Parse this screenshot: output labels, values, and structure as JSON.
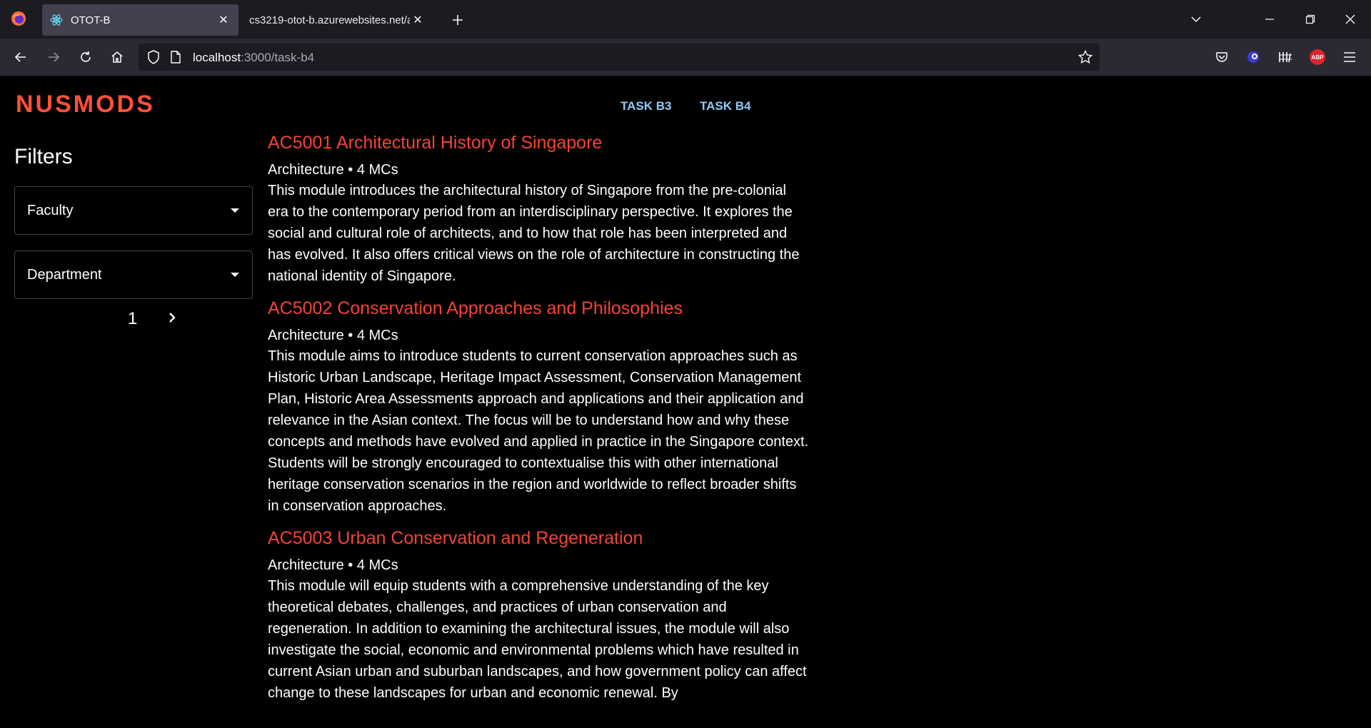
{
  "browser": {
    "tabs": [
      {
        "title": "OTOT-B",
        "active": true
      },
      {
        "title": "cs3219-otot-b.azurewebsites.net/ap",
        "active": false
      }
    ],
    "url": {
      "host": "localhost",
      "rest": ":3000/task-b4"
    }
  },
  "app": {
    "logo": "NUSMODS",
    "nav": [
      "TASK B3",
      "TASK B4"
    ]
  },
  "filters": {
    "title": "Filters",
    "faculty": "Faculty",
    "department": "Department",
    "page": "1"
  },
  "modules": [
    {
      "title": "AC5001 Architectural History of Singapore",
      "meta": "Architecture • 4 MCs",
      "description": "This module introduces the architectural history of Singapore from the pre-colonial era to the contemporary period from an interdisciplinary perspective. It explores the social and cultural role of architects, and to how that role has been interpreted and has evolved. It also offers critical views on the role of architecture in constructing the national identity of Singapore."
    },
    {
      "title": "AC5002 Conservation Approaches and Philosophies",
      "meta": "Architecture • 4 MCs",
      "description": "This module aims to introduce students to current conservation approaches such as Historic Urban Landscape, Heritage Impact Assessment, Conservation Management Plan, Historic Area Assessments approach and applications and their application and relevance in the Asian context. The focus will be to understand how and why these concepts and methods have evolved and applied in practice in the Singapore context. Students will be strongly encouraged to contextualise this with other international heritage conservation scenarios in the region and worldwide to reflect broader shifts in conservation approaches."
    },
    {
      "title": "AC5003 Urban Conservation and Regeneration",
      "meta": "Architecture • 4 MCs",
      "description": "This module will equip students with a comprehensive understanding of the key theoretical debates, challenges, and practices of urban conservation and regeneration. In addition to examining the architectural issues, the module will also investigate the social, economic and environmental problems which have resulted in current Asian urban and suburban landscapes, and how government policy can affect change to these landscapes for urban and economic renewal. By"
    }
  ],
  "colors": {
    "accent": "#ff5138",
    "title": "#f44336",
    "nav": "#90caf9"
  }
}
